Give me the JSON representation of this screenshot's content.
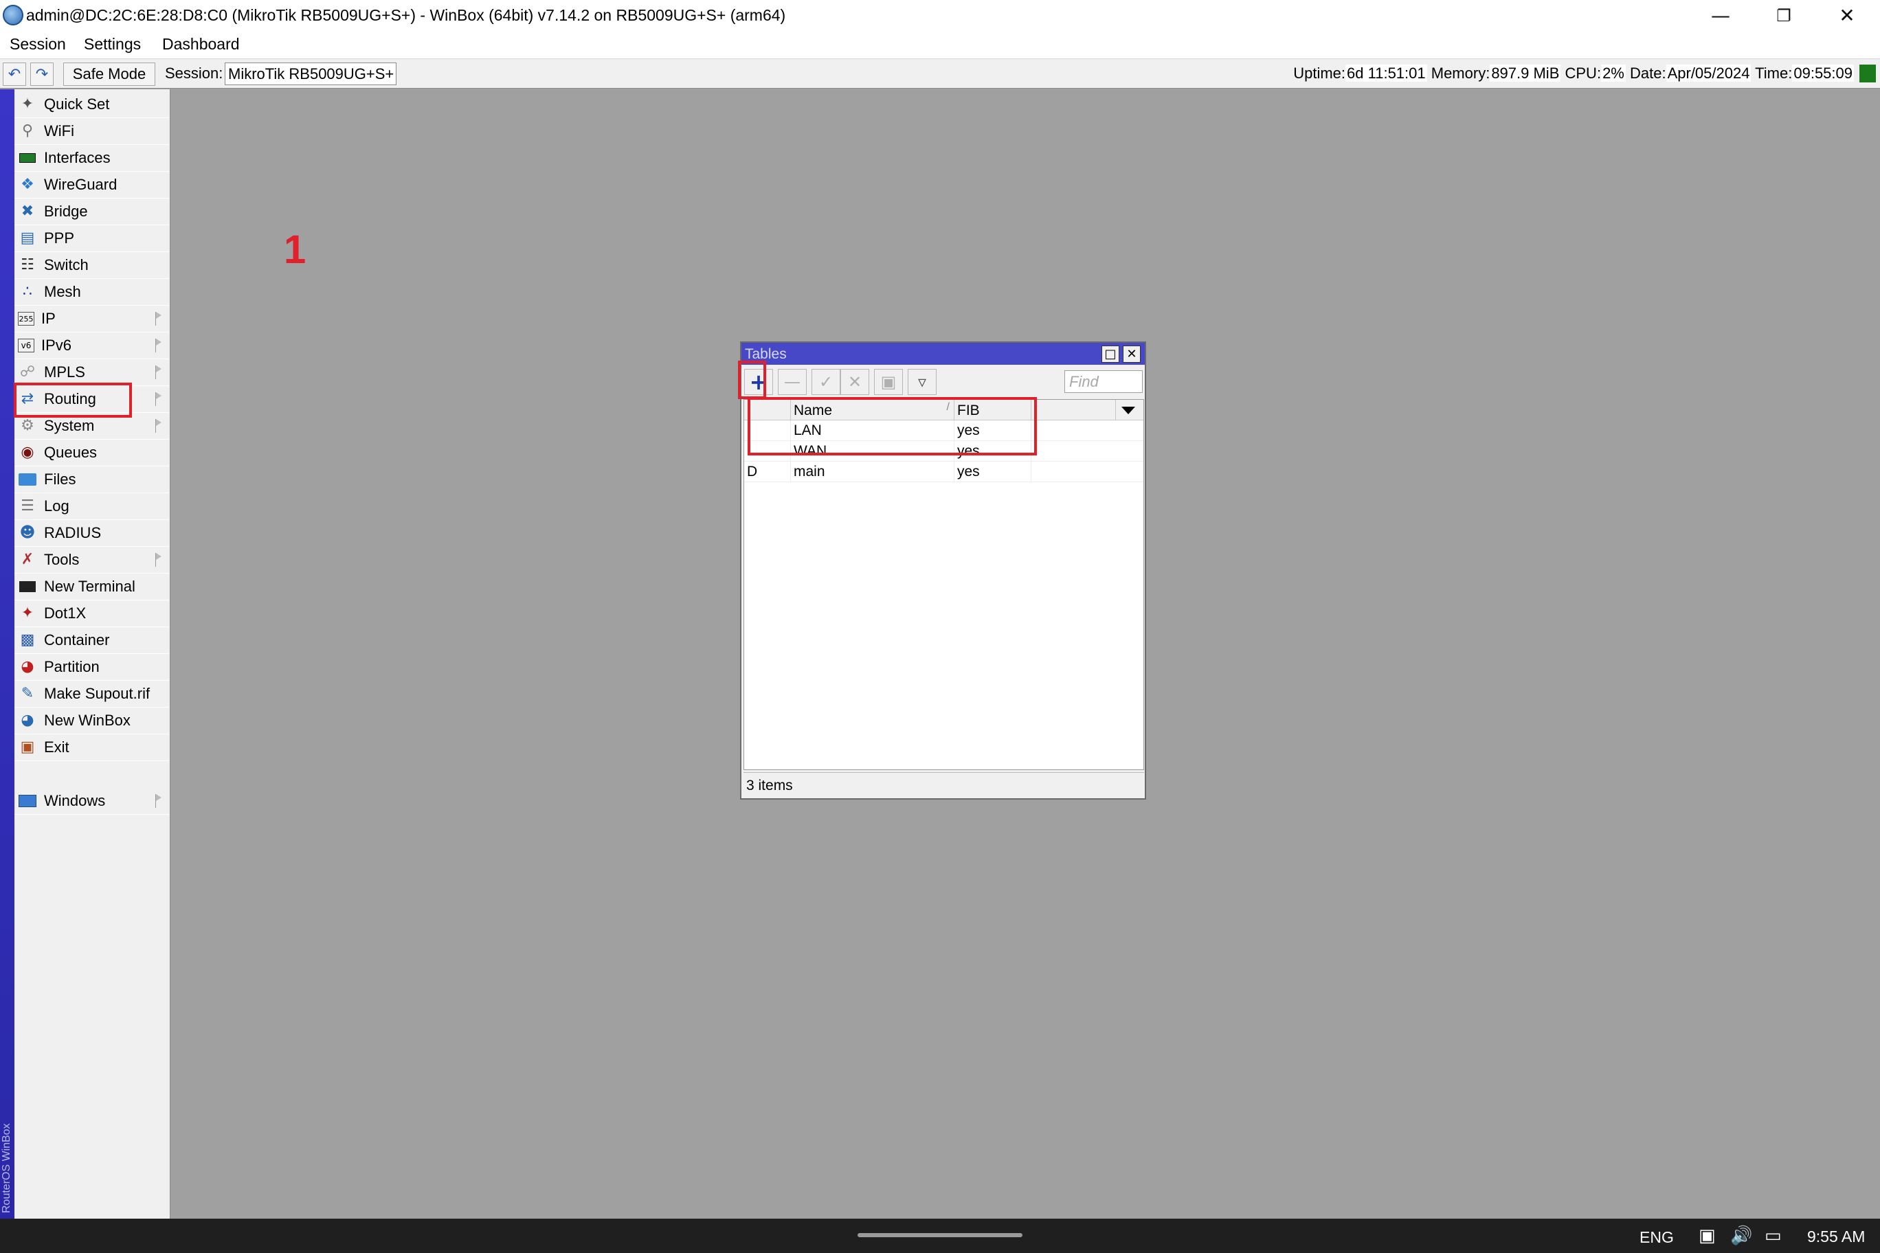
{
  "titlebar": {
    "title": "admin@DC:2C:6E:28:D8:C0 (MikroTik RB5009UG+S+) - WinBox (64bit) v7.14.2 on RB5009UG+S+ (arm64)"
  },
  "menubar": {
    "items": [
      "Session",
      "Settings",
      "Dashboard"
    ]
  },
  "toolbar": {
    "safe_mode_label": "Safe Mode",
    "session_label": "Session:",
    "session_value": "MikroTik RB5009UG+S+",
    "status": {
      "uptime_label": "Uptime:",
      "uptime_value": "6d 11:51:01",
      "memory_label": "Memory:",
      "memory_value": "897.9 MiB",
      "cpu_label": "CPU:",
      "cpu_value": "2%",
      "date_label": "Date:",
      "date_value": "Apr/05/2024",
      "time_label": "Time:",
      "time_value": "09:55:09"
    }
  },
  "side_strip_text": "RouterOS WinBox",
  "sidebar": {
    "items": [
      {
        "label": "Quick Set",
        "icon": "wand-icon"
      },
      {
        "label": "WiFi",
        "icon": "wifi-icon"
      },
      {
        "label": "Interfaces",
        "icon": "interfaces-icon"
      },
      {
        "label": "WireGuard",
        "icon": "wireguard-icon"
      },
      {
        "label": "Bridge",
        "icon": "bridge-icon"
      },
      {
        "label": "PPP",
        "icon": "ppp-icon"
      },
      {
        "label": "Switch",
        "icon": "switch-icon"
      },
      {
        "label": "Mesh",
        "icon": "mesh-icon"
      },
      {
        "label": "IP",
        "icon": "ip-icon",
        "icon_text": "255"
      },
      {
        "label": "IPv6",
        "icon": "ipv6-icon",
        "icon_text": "v6"
      },
      {
        "label": "MPLS",
        "icon": "mpls-icon"
      },
      {
        "label": "Routing",
        "icon": "routing-icon"
      },
      {
        "label": "System",
        "icon": "system-gear-icon"
      },
      {
        "label": "Queues",
        "icon": "queues-icon"
      },
      {
        "label": "Files",
        "icon": "folder-icon"
      },
      {
        "label": "Log",
        "icon": "log-icon"
      },
      {
        "label": "RADIUS",
        "icon": "radius-icon"
      },
      {
        "label": "Tools",
        "icon": "tools-icon"
      },
      {
        "label": "New Terminal",
        "icon": "terminal-icon"
      },
      {
        "label": "Dot1X",
        "icon": "dot1x-icon"
      },
      {
        "label": "Container",
        "icon": "container-icon"
      },
      {
        "label": "Partition",
        "icon": "partition-icon"
      },
      {
        "label": "Make Supout.rif",
        "icon": "supout-icon"
      },
      {
        "label": "New WinBox",
        "icon": "winbox-icon"
      },
      {
        "label": "Exit",
        "icon": "exit-icon"
      },
      {
        "label": "Windows",
        "icon": "windows-icon"
      }
    ]
  },
  "annotation": {
    "step_number": "1"
  },
  "tables_window": {
    "title": "Tables",
    "find_placeholder": "Find",
    "columns": [
      "Name",
      "FIB"
    ],
    "rows": [
      {
        "flag": "",
        "name": "LAN",
        "fib": "yes"
      },
      {
        "flag": "",
        "name": "WAN",
        "fib": "yes"
      },
      {
        "flag": "D",
        "name": "main",
        "fib": "yes"
      }
    ],
    "status": "3 items"
  },
  "taskbar": {
    "language": "ENG",
    "clock": "9:55 AM"
  },
  "colors": {
    "title_active": "#4648c8",
    "highlight": "#e0202a",
    "side_strip": "#3a35c7"
  }
}
